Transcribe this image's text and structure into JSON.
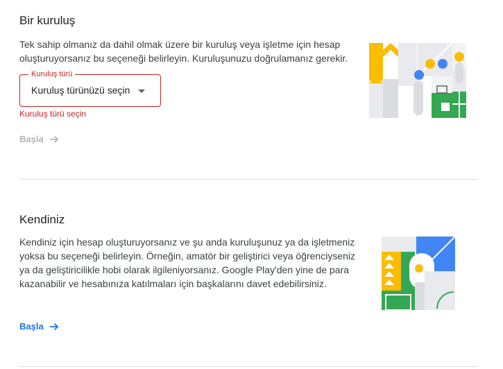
{
  "organization": {
    "title": "Bir kuruluş",
    "description": "Tek sahip olmanız da dahil olmak üzere bir kuruluş veya işletme için hesap oluşturuyorsanız bu seçeneği belirleyin. Kuruluşunuzu doğrulamanız gerekir.",
    "type_field": {
      "label": "Kuruluş türü",
      "value": "Kuruluş türünüzü seçin",
      "error": "Kuruluş türü seçin"
    },
    "start_label": "Başla"
  },
  "personal": {
    "title": "Kendiniz",
    "description": "Kendiniz için hesap oluşturuyorsanız ve şu anda kuruluşunuz ya da işletmeniz yoksa bu seçeneği belirleyin. Örneğin, amatör bir geliştirici veya öğrenciyseniz ya da geliştiricilikle hobi olarak ilgileniyorsanız. Google Play'den yine de para kazanabilir ve hesabınıza katılmaları için başkalarını davet edebilirsiniz.",
    "start_label": "Başla"
  },
  "colors": {
    "accent": "#1a73e8",
    "error": "#c5221f",
    "disabled": "#b0b3b8",
    "yellow": "#fbbc04",
    "green": "#34a853",
    "blue": "#4285f4",
    "grey": "#e8eaed"
  }
}
